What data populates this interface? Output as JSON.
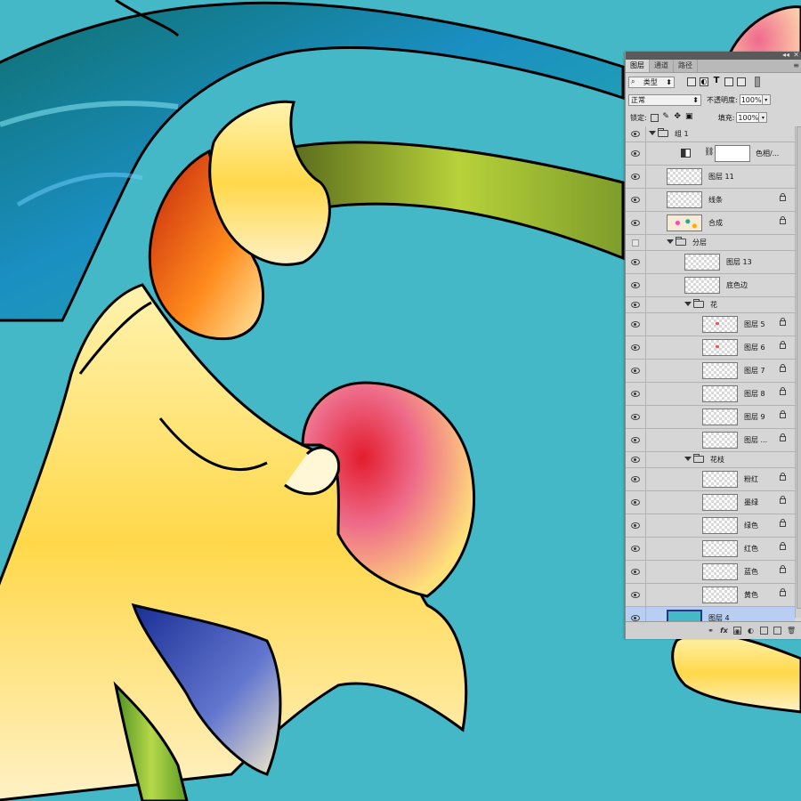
{
  "panel": {
    "tabs": [
      "图层",
      "通道",
      "路径"
    ],
    "filter": {
      "label": "类型"
    },
    "blend_mode": "正常",
    "opacity_label": "不透明度:",
    "opacity_value": "100%",
    "lock_label": "锁定:",
    "fill_label": "填充:",
    "fill_value": "100%"
  },
  "layers": [
    {
      "name": "组 1",
      "type": "group",
      "visible": true
    },
    {
      "name": "色相/...",
      "type": "adjustment",
      "visible": true
    },
    {
      "name": "图层 11",
      "type": "layer",
      "visible": true
    },
    {
      "name": "线条",
      "type": "layer",
      "visible": true,
      "locked": true
    },
    {
      "name": "合成",
      "type": "layer",
      "visible": true,
      "locked": true
    },
    {
      "name": "分层",
      "type": "group",
      "visible": false
    },
    {
      "name": "图层 13",
      "type": "layer",
      "visible": true
    },
    {
      "name": "底色边",
      "type": "layer",
      "visible": true
    },
    {
      "name": "花",
      "type": "group",
      "visible": true
    },
    {
      "name": "图层 5",
      "type": "layer",
      "visible": true,
      "locked": true
    },
    {
      "name": "图层 6",
      "type": "layer",
      "visible": true,
      "locked": true
    },
    {
      "name": "图层 7",
      "type": "layer",
      "visible": true,
      "locked": true
    },
    {
      "name": "图层 8",
      "type": "layer",
      "visible": true,
      "locked": true
    },
    {
      "name": "图层 9",
      "type": "layer",
      "visible": true,
      "locked": true
    },
    {
      "name": "图层 ...",
      "type": "layer",
      "visible": true,
      "locked": true
    },
    {
      "name": "花枝",
      "type": "group",
      "visible": true
    },
    {
      "name": "粉红",
      "type": "layer",
      "visible": true,
      "locked": true
    },
    {
      "name": "墨绿",
      "type": "layer",
      "visible": true,
      "locked": true
    },
    {
      "name": "绿色",
      "type": "layer",
      "visible": true,
      "locked": true
    },
    {
      "name": "红色",
      "type": "layer",
      "visible": true,
      "locked": true
    },
    {
      "name": "蓝色",
      "type": "layer",
      "visible": true,
      "locked": true
    },
    {
      "name": "黄色",
      "type": "layer",
      "visible": true,
      "locked": true
    },
    {
      "name": "图层 4",
      "type": "layer",
      "visible": true,
      "selected": true
    }
  ],
  "colors": {
    "canvas_bg": "#44b8c6",
    "panel_bg": "#d6d6d6",
    "selected_row": "#b9cef3"
  }
}
